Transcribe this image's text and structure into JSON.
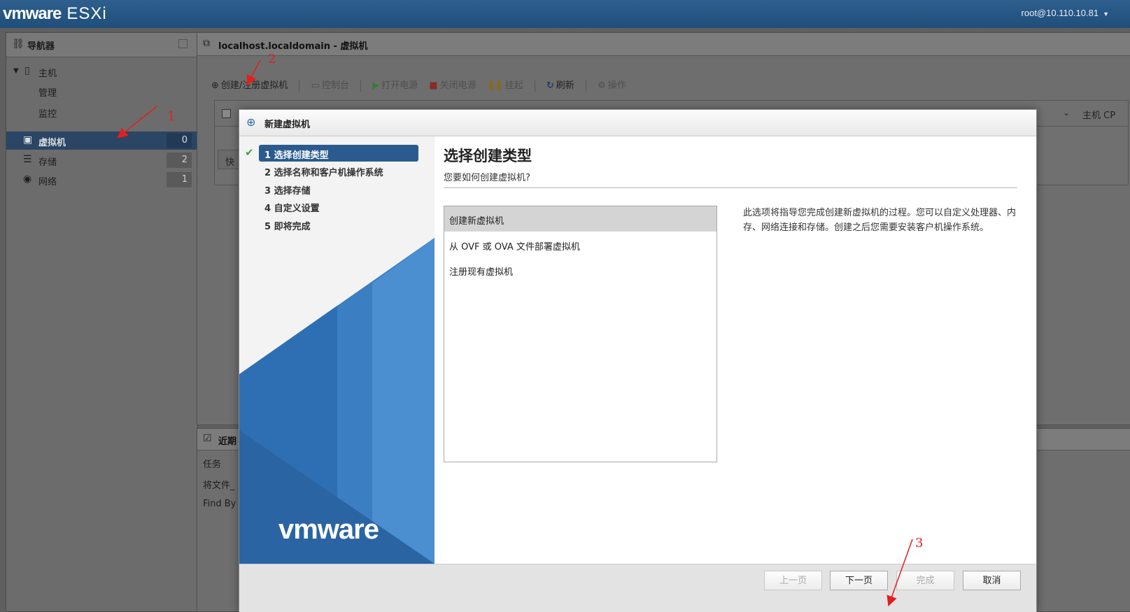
{
  "app": {
    "brand_vm": "vmware",
    "brand_product": "ESXi",
    "user": "root@10.110.10.81"
  },
  "navigator": {
    "title": "导航器",
    "host": "主机",
    "manage": "管理",
    "monitor": "监控",
    "items": [
      {
        "label": "虚拟机",
        "count": "0"
      },
      {
        "label": "存储",
        "count": "2"
      },
      {
        "label": "网络",
        "count": "1"
      }
    ]
  },
  "main": {
    "title": "localhost.localdomain - 虚拟机",
    "toolbar": {
      "create": "创建/注册虚拟机",
      "console": "控制台",
      "power_on": "打开电源",
      "power_off": "关闭电源",
      "suspend": "挂起",
      "refresh": "刷新",
      "actions": "操作"
    },
    "grid_col_host_cpu": "主机 CP",
    "quick_filter": "快"
  },
  "recent": {
    "title": "近期",
    "rows": [
      "任务",
      "将文件_",
      "Find By"
    ]
  },
  "dialog": {
    "title": "新建虚拟机",
    "steps": [
      "1 选择创建类型",
      "2 选择名称和客户机操作系统",
      "3 选择存储",
      "4 自定义设置",
      "5 即将完成"
    ],
    "heading": "选择创建类型",
    "subheading": "您要如何创建虚拟机?",
    "options": [
      "创建新虚拟机",
      "从 OVF 或 OVA 文件部署虚拟机",
      "注册现有虚拟机"
    ],
    "description": "此选项将指导您完成创建新虚拟机的过程。您可以自定义处理器、内存、网络连接和存储。创建之后您需要安装客户机操作系统。",
    "logo": "vmware",
    "buttons": {
      "back": "上一页",
      "next": "下一页",
      "finish": "完成",
      "cancel": "取消"
    }
  },
  "annotations": [
    "1",
    "2",
    "3"
  ],
  "colors": {
    "topbar": "#1f4e79",
    "selected_nav": "#2b4564",
    "active_step": "#2b5b8e",
    "annotation": "#e02020"
  }
}
